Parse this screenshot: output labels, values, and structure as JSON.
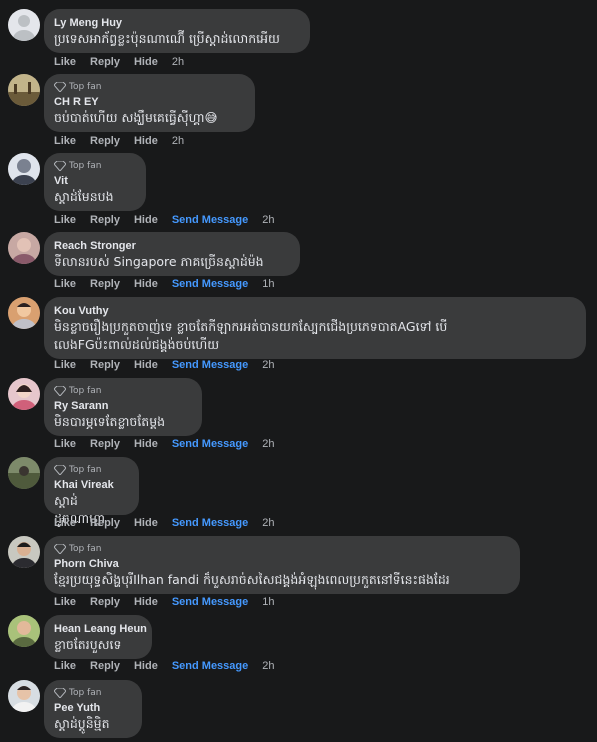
{
  "labels": {
    "top_fan": "Top fan",
    "like": "Like",
    "reply": "Reply",
    "hide": "Hide",
    "send_message": "Send Message"
  },
  "colors": {
    "background": "#18191a",
    "bubble": "#3a3b3c",
    "link_blue": "#4599ff",
    "muted": "#b0b3b8"
  },
  "comments": [
    {
      "name": "Ly Meng Huy",
      "top_fan": false,
      "text": "ប្រទេសអាភ័ព្វខ្លះប៉ុនណាណ៊ើ ប្រើស្តាដ់លោកអើយ",
      "send_message": false,
      "time": "2h",
      "avatar_icon": "default-avatar-icon"
    },
    {
      "name": "CH R EY",
      "top_fan": true,
      "text": "ចប់បាត់ហើយ សង្ឃឹមគេធ្វើស៊ីហ្គា😅",
      "send_message": false,
      "time": "2h",
      "avatar_icon": "landscape-avatar-icon"
    },
    {
      "name": "Vit",
      "top_fan": true,
      "text": "ស្តាដ់មែនបង",
      "send_message": true,
      "time": "2h",
      "avatar_icon": "person-avatar-icon"
    },
    {
      "name": "Reach Stronger",
      "top_fan": false,
      "text": "ទីលានរបស់ Singapore ភាគច្រើនស្តាដ់ម៉ង",
      "send_message": true,
      "time": "1h",
      "avatar_icon": "person-avatar-icon"
    },
    {
      "name": "Kou Vuthy",
      "top_fan": false,
      "text": "មិនខ្លាចរឿងប្រកួតចាញ់ទេ ខ្លាចតែកីឡាករអត់បានយកស្បែកជើងប្រភេទបាតAGទៅ បើ\nលេងFGប៉ះពាល់ដល់ជង្គង់ចប់ហើយ",
      "send_message": true,
      "time": "2h",
      "avatar_icon": "person-avatar-icon"
    },
    {
      "name": "Ry Sarann",
      "top_fan": true,
      "text": "មិនបារម្ភទេតែខ្លាចតែម្តង",
      "send_message": true,
      "time": "2h",
      "avatar_icon": "person-avatar-icon"
    },
    {
      "name": "Khai Vireak",
      "top_fan": true,
      "text": "ស្តាដ់ដូចណាហ្កា",
      "send_message": true,
      "time": "2h",
      "avatar_icon": "landscape-avatar-icon"
    },
    {
      "name": "Phorn Chiva",
      "top_fan": true,
      "text": "ខ្មែរប្រយុទ្ធសិង្ហបុរីIlhan fandi ក៏បួសរាច់សសៃជង្គង់អំឡុងពេលប្រកួតនៅទីនេះផងដែរ",
      "send_message": true,
      "time": "1h",
      "avatar_icon": "person-avatar-icon"
    },
    {
      "name": "Hean Leang Heun",
      "top_fan": false,
      "text": "ខ្លាចតែរបួសទេ",
      "send_message": true,
      "time": "2h",
      "avatar_icon": "person-avatar-icon"
    },
    {
      "name": "Pee Yuth",
      "top_fan": true,
      "text": "ស្តាដ់ប្តូនិម្មិត",
      "send_message": false,
      "time": "",
      "avatar_icon": "person-avatar-icon"
    }
  ]
}
